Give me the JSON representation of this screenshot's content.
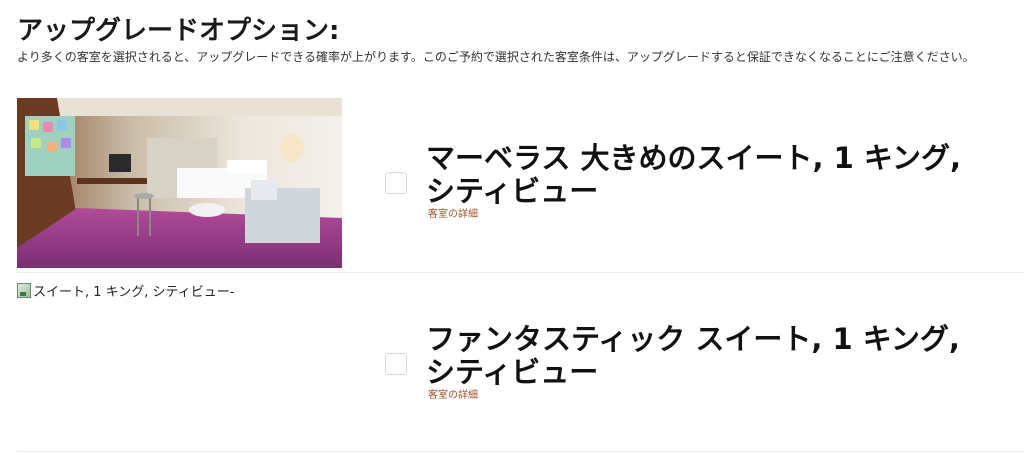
{
  "header": {
    "title": "アップグレードオプション:",
    "description": "より多くの客室を選択されると、アップグレードできる確率が上がります。このご予約で選択された客室条件は、アップグレードすると保証できなくなることにご注意ください。"
  },
  "rooms": [
    {
      "name": "マーベラス 大きめのスイート, 1 キング, シティビュー",
      "detail_link": "客室の詳細",
      "checked": false
    },
    {
      "name": "ファンタスティック スイート, 1 キング, シティビュー",
      "detail_link": "客室の詳細",
      "checked": false,
      "image_alt": "スイート, 1 キング, シティビュー-"
    }
  ],
  "colors": {
    "link": "#a0522d",
    "divider": "#ececec"
  }
}
